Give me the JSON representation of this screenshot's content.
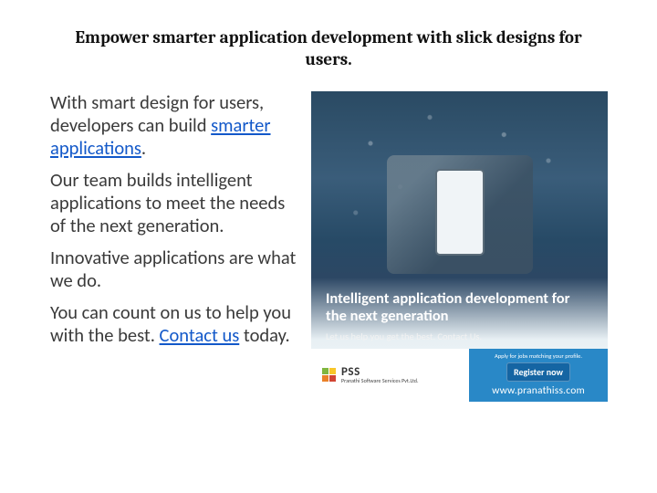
{
  "title": "Empower smarter application development with slick designs for users.",
  "body": {
    "p1a": "With smart design for users, developers can build ",
    "p1_link": "smarter applications",
    "p1b": ".",
    "p2": "Our team builds intelligent applications to meet the needs of the next generation.",
    "p3": "Innovative applications are what we do.",
    "p4a": "You can count on us to help you with the best. ",
    "p4_link": "Contact us",
    "p4b": " today."
  },
  "promo": {
    "headline": "Intelligent application development for the next generation",
    "sub": "Let us help you get the best. Contact Us.",
    "logo_name": "PSS",
    "logo_sub": "Pranathi Software Services Pvt.Ltd.",
    "apply": "Apply for jobs matching your profile.",
    "register": "Register now",
    "url": "www.pranathiss.com"
  }
}
